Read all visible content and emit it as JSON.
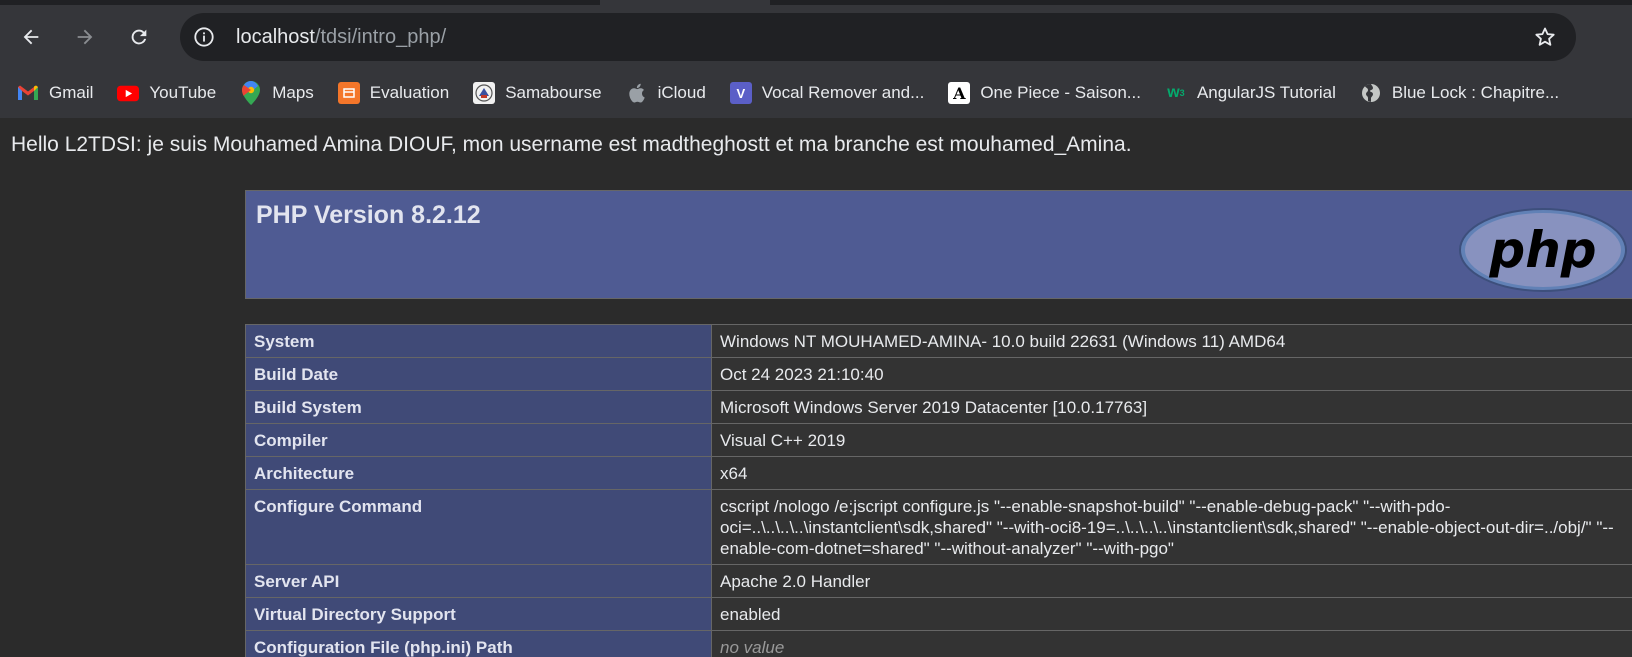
{
  "browser": {
    "url_host": "localhost",
    "url_path": "/tdsi/intro_php/",
    "back_icon": "arrow-left-icon",
    "forward_icon": "arrow-right-icon",
    "reload_icon": "reload-icon",
    "bookmark_star_icon": "star-icon",
    "bookmarks": [
      {
        "label": "Gmail",
        "icon": "gmail-icon"
      },
      {
        "label": "YouTube",
        "icon": "youtube-icon"
      },
      {
        "label": "Maps",
        "icon": "maps-icon"
      },
      {
        "label": "Evaluation",
        "icon": "evaluation-icon"
      },
      {
        "label": "Samabourse",
        "icon": "samabourse-icon"
      },
      {
        "label": "iCloud",
        "icon": "apple-icon"
      },
      {
        "label": "Vocal Remover and...",
        "icon": "vocal-remover-icon"
      },
      {
        "label": "One Piece - Saison...",
        "icon": "one-piece-icon"
      },
      {
        "label": "AngularJS Tutorial",
        "icon": "w3schools-icon"
      },
      {
        "label": "Blue Lock : Chapitre...",
        "icon": "globe-icon"
      }
    ]
  },
  "page": {
    "hello": "Hello L2TDSI: je suis Mouhamed Amina DIOUF, mon username est madtheghostt et ma branche est mouhamed_Amina.",
    "php_version_title": "PHP Version 8.2.12",
    "logo_text": "php",
    "rows": [
      {
        "key": "System",
        "value": "Windows NT MOUHAMED-AMINA- 10.0 build 22631 (Windows 11) AMD64"
      },
      {
        "key": "Build Date",
        "value": "Oct 24 2023 21:10:40"
      },
      {
        "key": "Build System",
        "value": "Microsoft Windows Server 2019 Datacenter [10.0.17763]"
      },
      {
        "key": "Compiler",
        "value": "Visual C++ 2019"
      },
      {
        "key": "Architecture",
        "value": "x64"
      },
      {
        "key": "Configure Command",
        "value": "cscript /nologo /e:jscript configure.js \"--enable-snapshot-build\" \"--enable-debug-pack\" \"--with-pdo-oci=..\\..\\..\\..\\instantclient\\sdk,shared\" \"--with-oci8-19=..\\..\\..\\..\\instantclient\\sdk,shared\" \"--enable-object-out-dir=../obj/\" \"--enable-com-dotnet=shared\" \"--without-analyzer\" \"--with-pgo\""
      },
      {
        "key": "Server API",
        "value": "Apache 2.0 Handler"
      },
      {
        "key": "Virtual Directory Support",
        "value": "enabled"
      },
      {
        "key": "Configuration File (php.ini) Path",
        "value": "no value"
      }
    ]
  }
}
